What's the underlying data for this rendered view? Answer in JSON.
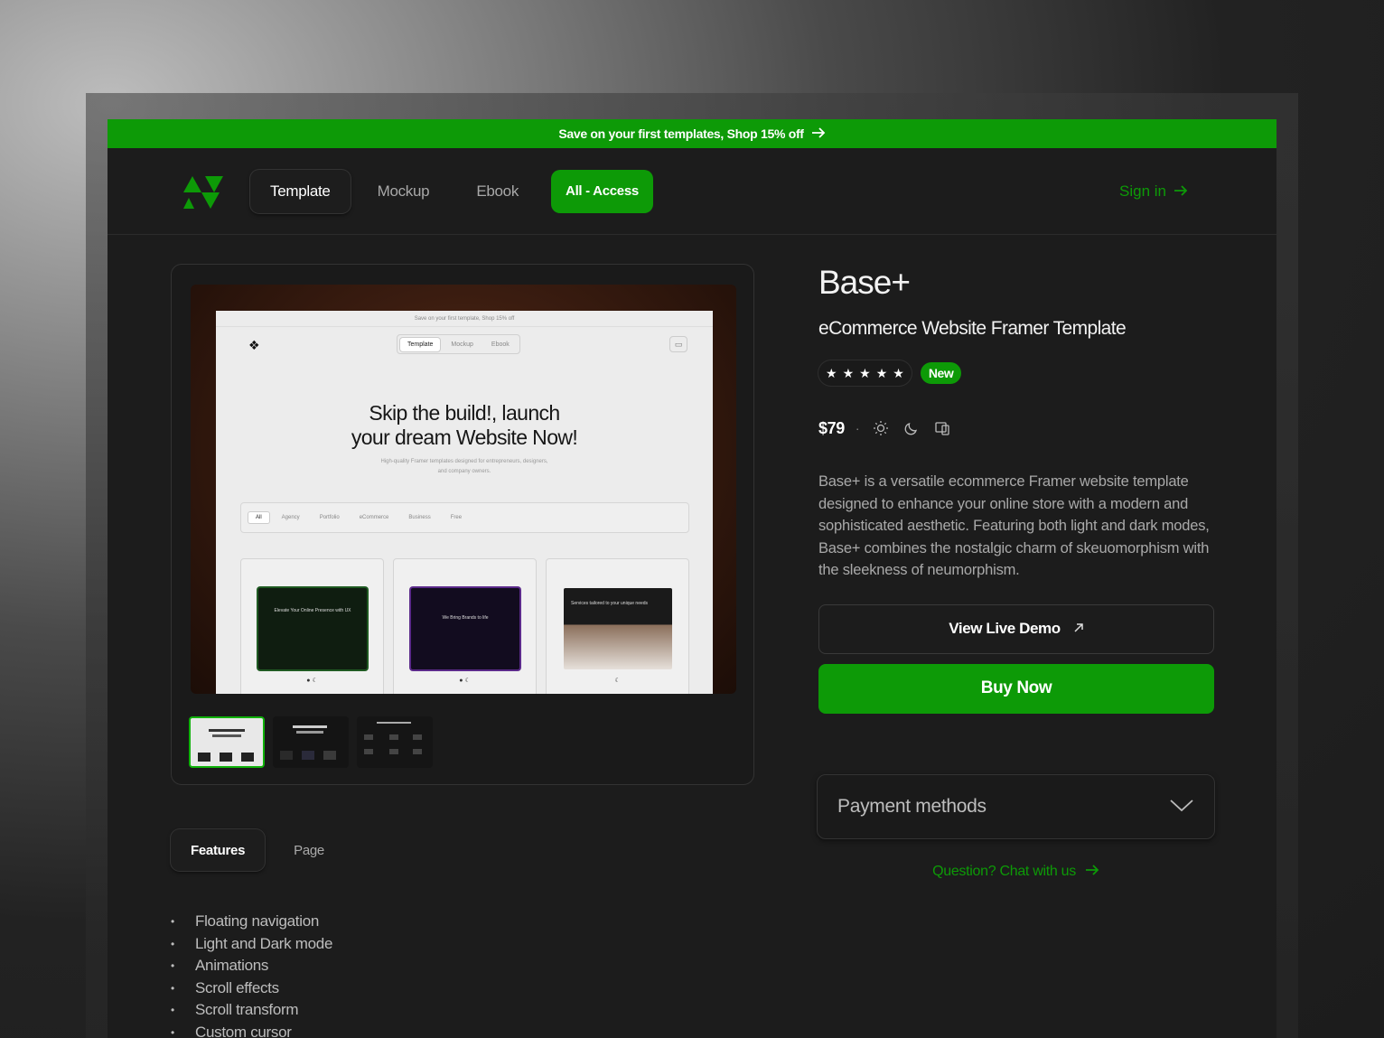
{
  "promo": {
    "text": "Save on your first templates, Shop 15% off",
    "arrow_icon": "arrow-right-icon"
  },
  "nav": {
    "items": [
      {
        "label": "Template",
        "active": true
      },
      {
        "label": "Mockup",
        "active": false
      },
      {
        "label": "Ebook",
        "active": false
      }
    ],
    "cta_label": "All - Access",
    "signin_label": "Sign in"
  },
  "preview": {
    "mock_promo": "Save on your first template, Shop 15% off",
    "mock_nav": [
      "Template",
      "Mockup",
      "Ebook"
    ],
    "headline_line1": "Skip the build!, launch",
    "headline_line2": "your dream Website Now!",
    "subtext": "High-quality Framer templates designed for entrepreneurs, designers, and company owners.",
    "filters": [
      "All",
      "Agency",
      "Portfolio",
      "eCommerce",
      "Business",
      "Free"
    ],
    "cards": [
      {
        "text": "Elevate Your Online Presence with UX"
      },
      {
        "text": "We Bring Brands to life"
      },
      {
        "text": "Services tailored to your unique needs"
      }
    ]
  },
  "tabs": [
    {
      "label": "Features",
      "active": true
    },
    {
      "label": "Page",
      "active": false
    }
  ],
  "features": [
    "Floating navigation",
    "Light and Dark mode",
    "Animations",
    "Scroll effects",
    "Scroll transform",
    "Custom cursor"
  ],
  "product": {
    "title": "Base+",
    "subtitle": "eCommerce Website Framer Template",
    "rating_stars": 5,
    "badge": "New",
    "price": "$79",
    "separator": "·",
    "description": "Base+ is a versatile ecommerce Framer website template designed to enhance your online store with a modern and sophisticated aesthetic. Featuring both light and dark modes, Base+ combines the nostalgic charm of skeuomorphism with the sleekness of neumorphism.",
    "demo_label": "View Live Demo",
    "buy_label": "Buy Now"
  },
  "payment": {
    "label": "Payment methods"
  },
  "chat": {
    "label": "Question? Chat with us"
  },
  "colors": {
    "accent": "#0d9a07",
    "background": "#1c1c1c"
  }
}
